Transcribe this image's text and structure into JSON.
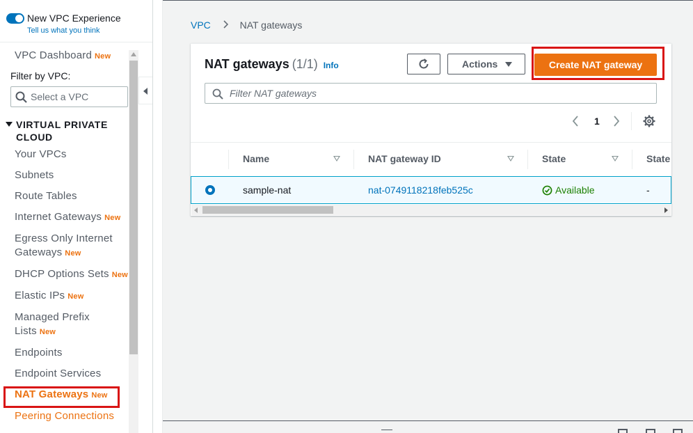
{
  "sidebar": {
    "experience_label": "New VPC Experience",
    "feedback_link": "Tell us what you think",
    "filter_label": "Filter by VPC:",
    "filter_placeholder": "Select a VPC",
    "section_title": "VIRTUAL PRIVATE CLOUD",
    "items": [
      {
        "label": "VPC Dashboard",
        "badge": "New"
      },
      {
        "label": "Your VPCs"
      },
      {
        "label": "Subnets"
      },
      {
        "label": "Route Tables"
      },
      {
        "label": "Internet Gateways",
        "badge": "New"
      },
      {
        "label": "Egress Only Internet Gateways",
        "badge": "New"
      },
      {
        "label": "DHCP Options Sets",
        "badge": "New"
      },
      {
        "label": "Elastic IPs",
        "badge": "New"
      },
      {
        "label": "Managed Prefix Lists",
        "badge": "New"
      },
      {
        "label": "Endpoints"
      },
      {
        "label": "Endpoint Services"
      },
      {
        "label": "NAT Gateways",
        "badge": "New",
        "active": true
      },
      {
        "label": "Peering Connections"
      }
    ]
  },
  "breadcrumb": [
    "VPC",
    "NAT gateways"
  ],
  "panel": {
    "title": "NAT gateways",
    "count": "(1/1)",
    "info_label": "Info",
    "actions_label": "Actions",
    "create_label": "Create NAT gateway",
    "filter_placeholder": "Filter NAT gateways",
    "page": "1"
  },
  "table": {
    "columns": [
      "Name",
      "NAT gateway ID",
      "State",
      "State"
    ],
    "rows": [
      {
        "name": "sample-nat",
        "id": "nat-0749118218feb525c",
        "state": "Available",
        "state_message": "-",
        "selected": true
      }
    ]
  },
  "colors": {
    "accent_orange": "#ec7211",
    "link_blue": "#0073bb",
    "success_green": "#1d8102",
    "highlight_red": "#d91515"
  }
}
